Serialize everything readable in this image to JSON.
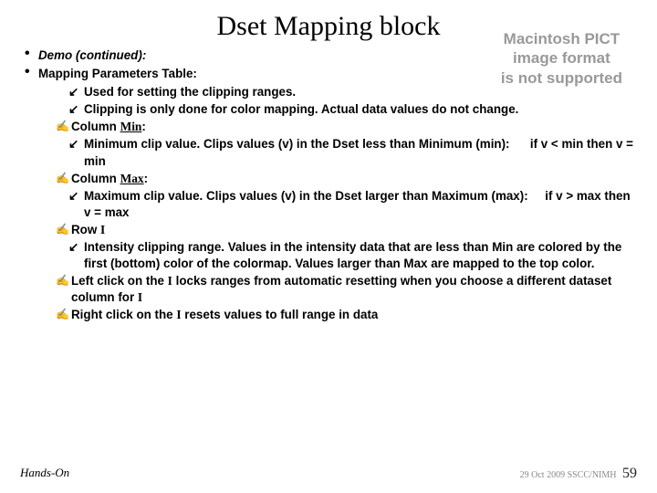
{
  "title": "Dset Mapping block",
  "pict_error_l1": "Macintosh PICT",
  "pict_error_l2": "image format",
  "pict_error_l3": "is not supported",
  "l1a": "Demo (continued):",
  "l1b": "Mapping Parameters Table:",
  "l2a": "Used for setting the clipping ranges.",
  "l2b": "Clipping is only done for color mapping. Actual data values do not change.",
  "col_min_prefix": "Column ",
  "col_min_label": "Min",
  "col_min_suffix": ":",
  "min_desc_a": "Minimum clip value. Clips values (v) in the Dset less than Minimum (min):",
  "min_rule": "if v < min then v = min",
  "col_max_prefix": "Column ",
  "col_max_label": "Max",
  "col_max_suffix": ":",
  "max_desc_a": "Maximum clip value. Clips values (v) in the Dset larger than Maximum (max):",
  "max_rule": "if v > max then v = max",
  "row_i_prefix": "Row ",
  "row_i_label": "I",
  "intensity_desc": "Intensity clipping range. Values in the intensity data that are less than Min are colored by the first (bottom) color of the colormap. Values larger than Max are mapped to the top color.",
  "left_click_a": "Left click",
  "left_click_b": " on the ",
  "left_click_c": "I",
  "left_click_d": " locks ranges from automatic resetting when you choose a different dataset column for ",
  "left_click_e": "I",
  "right_click_a": "Right click",
  "right_click_b": " on the ",
  "right_click_c": "I",
  "right_click_d": " resets values to full range in data",
  "footer_left": "Hands-On",
  "footer_right_date": "29 Oct 2009 SSCC/NIMH",
  "footer_right_page": "59",
  "bullet_dot": "•",
  "bullet_arrow": "↙",
  "bullet_hand": "✍"
}
